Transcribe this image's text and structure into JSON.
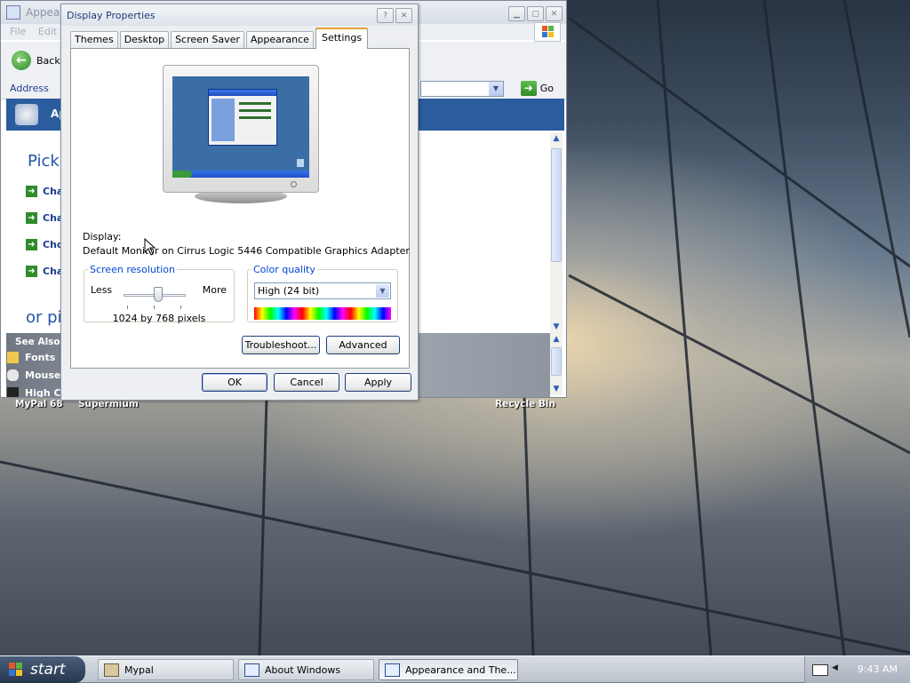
{
  "background_window": {
    "title": "Appearance and Themes",
    "menu": [
      "File",
      "Edit"
    ],
    "back_label": "Back",
    "address_label": "Address",
    "go_label": "Go",
    "banner_text": "Ap",
    "pick_title": "Pick",
    "tasks": [
      "Cha",
      "Cha",
      "Cho",
      "Cha"
    ],
    "or_pick": "or pi",
    "see_also_title": "See Also",
    "see_also_items": [
      "Fonts",
      "Mouse I",
      "High Co"
    ]
  },
  "desktop_icons": [
    "MyPal 68",
    "Supermium",
    "Recycle Bin"
  ],
  "dialog": {
    "title": "Display Properties",
    "tabs": [
      "Themes",
      "Desktop",
      "Screen Saver",
      "Appearance",
      "Settings"
    ],
    "active_tab": "Settings",
    "display_label": "Display:",
    "display_value": "Default Monitor on Cirrus Logic 5446 Compatible Graphics Adapter",
    "screen_resolution": {
      "legend": "Screen resolution",
      "less": "Less",
      "more": "More",
      "value_text": "1024 by 768 pixels",
      "slider_position": 0.5
    },
    "color_quality": {
      "legend": "Color quality",
      "selected": "High (24 bit)"
    },
    "buttons": {
      "troubleshoot": "Troubleshoot...",
      "advanced": "Advanced",
      "ok": "OK",
      "cancel": "Cancel",
      "apply": "Apply"
    }
  },
  "taskbar": {
    "start_label": "start",
    "tasks": [
      "Mypal",
      "About Windows",
      "Appearance and The..."
    ],
    "active_task": "Appearance and The...",
    "clock": "9:43 AM"
  },
  "colors": {
    "title_text": "#1d3a78",
    "group_legend": "#0046d5",
    "active_tab_accent": "#e6a33d",
    "banner_blue": "#2b5d9e"
  }
}
